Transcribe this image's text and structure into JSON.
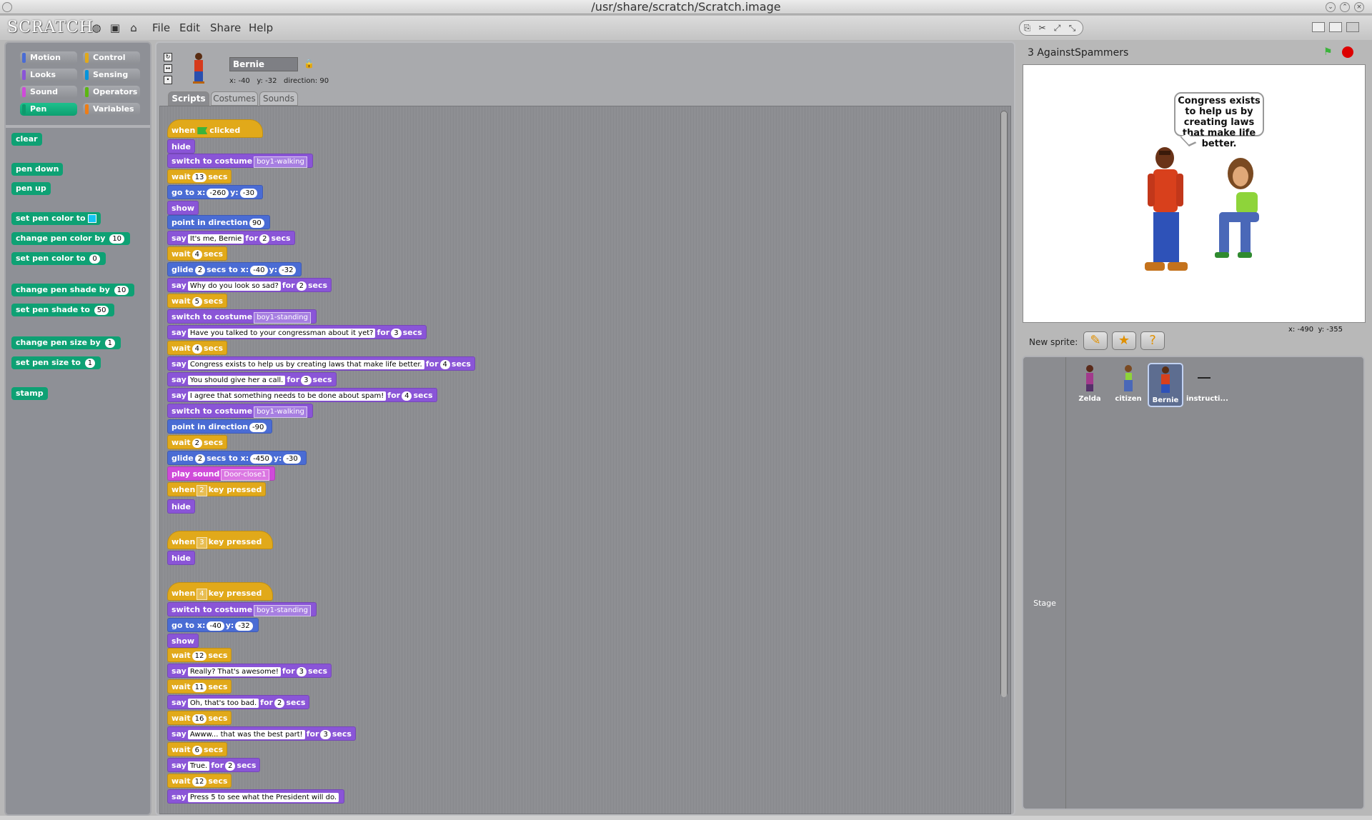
{
  "window": {
    "title": "/usr/share/scratch/Scratch.image"
  },
  "menubar": {
    "logo": "SCRATCH",
    "menus": [
      "File",
      "Edit",
      "Share",
      "Help"
    ]
  },
  "palette": {
    "categories": [
      {
        "label": "Motion",
        "color": "#4a6cd4"
      },
      {
        "label": "Control",
        "color": "#e1a91a"
      },
      {
        "label": "Looks",
        "color": "#8a55d7"
      },
      {
        "label": "Sensing",
        "color": "#0494dc"
      },
      {
        "label": "Sound",
        "color": "#cf4ad9"
      },
      {
        "label": "Operators",
        "color": "#5cb712"
      },
      {
        "label": "Pen",
        "color": "#0e9a6c",
        "selected": true
      },
      {
        "label": "Variables",
        "color": "#ee7d16"
      }
    ],
    "blocks": {
      "clear": "clear",
      "pen_down": "pen down",
      "pen_up": "pen up",
      "set_color_a": "set pen color to",
      "change_color_a": "change pen color by",
      "change_color_v": "10",
      "set_color_b": "set pen color to",
      "set_color_v": "0",
      "change_shade_a": "change pen shade by",
      "change_shade_v": "10",
      "set_shade_a": "set pen shade to",
      "set_shade_v": "50",
      "change_size_a": "change pen size by",
      "change_size_v": "1",
      "set_size_a": "set pen size to",
      "set_size_v": "1",
      "stamp": "stamp"
    }
  },
  "sprite": {
    "name": "Bernie",
    "x": "x: -40",
    "y": "y: -32",
    "direction": "direction: 90"
  },
  "tabs": [
    "Scripts",
    "Costumes",
    "Sounds"
  ],
  "words": {
    "when": "when",
    "clicked": "clicked",
    "hide": "hide",
    "show": "show",
    "switch": "switch to costume",
    "wait": "wait",
    "secs": "secs",
    "goto": "go to x:",
    "y": "y:",
    "point": "point in direction",
    "say": "say",
    "for": "for",
    "glide": "glide",
    "secs_to_x": "secs to x:",
    "play": "play sound",
    "key_pressed": "key pressed"
  },
  "script1": {
    "costume1": "boy1-walking",
    "wait1": "13",
    "gx": "-260",
    "gy": "-30",
    "dir1": "90",
    "say1": "It's me, Bernie",
    "say1t": "2",
    "wait2": "4",
    "glide1": "2",
    "glide1x": "-40",
    "glide1y": "-32",
    "say2": "Why do you look so sad?",
    "say2t": "2",
    "wait3": "5",
    "costume2": "boy1-standing",
    "say3": "Have you talked to your congressman about it yet?",
    "say3t": "3",
    "wait4": "4",
    "say4": "Congress exists to help us by creating laws that make life better.",
    "say4t": "4",
    "say5": "You should give her a call.",
    "say5t": "3",
    "say6": "I agree that something needs to be done about spam!",
    "say6t": "4",
    "costume3": "boy1-walking",
    "dir2": "-90",
    "wait5": "2",
    "glide2": "2",
    "glide2x": "-450",
    "glide2y": "-30",
    "sound": "Door-close1"
  },
  "script2": {
    "key": "2"
  },
  "script3": {
    "key": "3"
  },
  "script4": {
    "key": "4",
    "costume": "boy1-standing",
    "gx": "-40",
    "gy": "-32",
    "wait1": "12",
    "say1": "Really? That's awesome!",
    "say1t": "3",
    "wait2": "11",
    "say2": "Oh, that's too bad.",
    "say2t": "2",
    "wait3": "16",
    "say3": "Awww... that was the best part!",
    "say3t": "3",
    "wait4": "6",
    "say4": "True.",
    "say4t": "2",
    "wait5": "12",
    "say5": "Press 5 to see what the President will do."
  },
  "stage": {
    "project_name": "3 AgainstSpammers",
    "speech": "Congress exists to help us by creating laws that make life better.",
    "mouse_x": "x: -490",
    "mouse_y": "y: -355"
  },
  "new_sprite": {
    "label": "New sprite:"
  },
  "sprites": [
    {
      "name": "Zelda"
    },
    {
      "name": "citizen"
    },
    {
      "name": "Bernie",
      "selected": true
    },
    {
      "name": "instructi..."
    }
  ],
  "stage_label": "Stage"
}
